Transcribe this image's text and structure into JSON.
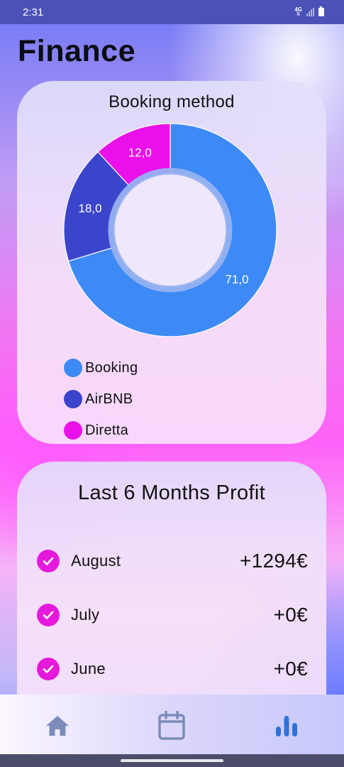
{
  "status_bar": {
    "time": "2:31",
    "network": "4G",
    "signal_icon": "cellular-signal-icon",
    "battery_icon": "battery-icon"
  },
  "page": {
    "title": "Finance"
  },
  "booking_card": {
    "title": "Booking method",
    "chart_data": {
      "type": "pie",
      "variant": "donut",
      "title": "Booking method",
      "categories": [
        "Booking",
        "AirBNB",
        "Diretta"
      ],
      "values": [
        71.0,
        18.0,
        12.0
      ],
      "labels": [
        "71,0",
        "18,0",
        "12,0"
      ],
      "colors": [
        "#3d8af7",
        "#3b45cc",
        "#ea10ea"
      ],
      "legend": "bottom-left"
    },
    "legend": [
      {
        "label": "Booking",
        "color": "#3d8af7"
      },
      {
        "label": "AirBNB",
        "color": "#3b45cc"
      },
      {
        "label": "Diretta",
        "color": "#ea10ea"
      }
    ]
  },
  "profit_card": {
    "title": "Last 6 Months Profit",
    "rows": [
      {
        "month": "August",
        "amount": "+1294€",
        "icon": "check-circle-icon"
      },
      {
        "month": "July",
        "amount": "+0€",
        "icon": "check-circle-icon"
      },
      {
        "month": "June",
        "amount": "+0€",
        "icon": "check-circle-icon"
      }
    ]
  },
  "bottom_nav": {
    "items": [
      {
        "icon": "home-icon",
        "active": false
      },
      {
        "icon": "calendar-icon",
        "active": false
      },
      {
        "icon": "bar-chart-icon",
        "active": true
      }
    ],
    "active_color": "#2f73d9",
    "inactive_color": "#7b8cb8"
  }
}
